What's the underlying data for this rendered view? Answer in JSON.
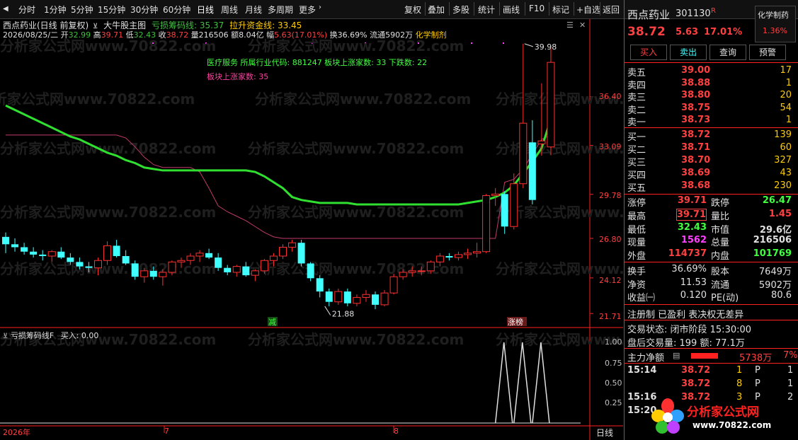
{
  "toolbar": {
    "periods": [
      "分时",
      "1分钟",
      "5分钟",
      "15分钟",
      "30分钟",
      "60分钟",
      "日线",
      "周线",
      "月线",
      "多周期",
      "更多"
    ],
    "right": [
      "复权",
      "叠加",
      "多股",
      "统计",
      "画线",
      "F10",
      "标记",
      "+自选",
      "返回"
    ]
  },
  "header": {
    "title": "西点药业(日线 前复权)",
    "template": "大牛股主图",
    "ind1_label": "亏损筹码线",
    "ind1_val": "35.37",
    "ind2_label": "拉升资金线",
    "ind2_val": "33.45",
    "date": "2026/08/25/二",
    "open_l": "开",
    "open": "32.99",
    "high_l": "高",
    "high": "39.71",
    "low_l": "低",
    "low": "32.43",
    "close_l": "收",
    "close": "38.72",
    "vol_l": "量",
    "vol": "216506",
    "amt_l": "额",
    "amt": "8.04亿",
    "chg_l": "幅",
    "chg": "5.63(17.01%)",
    "turn_l": "换",
    "turn": "36.69%",
    "float_l": "流通",
    "float": "5902万",
    "concept": "化学制剂"
  },
  "annotations": {
    "industry": "医疗服务  所属行业代码: 881247 板块上涨家数: 33 下跌数: 22",
    "up_count": "板块上涨家数: 35",
    "high_mark": "39.98",
    "low_mark": "21.88",
    "tag_reduce": "减",
    "tag_limit": "涨榜",
    "watermark": "分析家公式网www.70822.com"
  },
  "y_axis": [
    "36.40",
    "33.09",
    "29.78",
    "26.80",
    "24.12",
    "21.71"
  ],
  "indicator": {
    "title": "亏损筹码线F",
    "buy_label": "买入:",
    "buy_val": "0.00",
    "y_axis": [
      "1.00",
      "0.75",
      "0.50",
      "0.25"
    ]
  },
  "x_axis": [
    "2026年",
    "7",
    "8"
  ],
  "period_label": "日线",
  "stock": {
    "name": "西点药业",
    "code": "301130",
    "flag": "R",
    "price": "38.72",
    "change": "5.63",
    "pct": "17.01%",
    "concept": "化学制药",
    "concept_pct": "1.36%"
  },
  "buttons": [
    "买入",
    "卖出",
    "查询",
    "预警"
  ],
  "asks": [
    {
      "label": "卖五",
      "price": "39.00",
      "vol": "17"
    },
    {
      "label": "卖四",
      "price": "38.88",
      "vol": "1"
    },
    {
      "label": "卖三",
      "price": "38.80",
      "vol": "20"
    },
    {
      "label": "卖二",
      "price": "38.75",
      "vol": "54"
    },
    {
      "label": "卖一",
      "price": "38.73",
      "vol": "1"
    }
  ],
  "bids": [
    {
      "label": "买一",
      "price": "38.72",
      "vol": "139"
    },
    {
      "label": "买二",
      "price": "38.71",
      "vol": "60"
    },
    {
      "label": "买三",
      "price": "38.70",
      "vol": "327"
    },
    {
      "label": "买四",
      "price": "38.69",
      "vol": "43"
    },
    {
      "label": "买五",
      "price": "38.68",
      "vol": "230"
    }
  ],
  "stats": [
    {
      "l": "涨停",
      "v": "39.71",
      "l2": "跌停",
      "v2": "26.47"
    },
    {
      "l": "最高",
      "v": "39.71",
      "l2": "量比",
      "v2": "1.45"
    },
    {
      "l": "最低",
      "v": "32.43",
      "l2": "市值",
      "v2": "29.6亿"
    },
    {
      "l": "现量",
      "v": "1562",
      "l2": "总量",
      "v2": "216506"
    },
    {
      "l": "外盘",
      "v": "114737",
      "l2": "内盘",
      "v2": "101769"
    }
  ],
  "fin": [
    {
      "l": "换手",
      "v": "36.69%",
      "l2": "股本",
      "v2": "7649万"
    },
    {
      "l": "净资",
      "v": "11.53",
      "l2": "流通",
      "v2": "5902万"
    },
    {
      "l": "收益㈠",
      "v": "0.120",
      "l2": "PE(动)",
      "v2": "80.6"
    }
  ],
  "info": {
    "reg": "注册制 已盈利 表决权无差异",
    "status": "交易状态: 闭市阶段 15:30:00",
    "after": "盘后交易量: 199  额: 77.1万",
    "main_label": "主力净额",
    "main_val": "5738万",
    "main_pct": "7%"
  },
  "ticks": [
    {
      "t": "15:14",
      "p": "38.72",
      "v": "1",
      "s": "P",
      "n": "1"
    },
    {
      "t": "",
      "p": "38.72",
      "v": "8",
      "s": "P",
      "n": "1"
    },
    {
      "t": "15:16",
      "p": "38.72",
      "v": "3",
      "s": "P",
      "n": "2"
    },
    {
      "t": "15:20",
      "p": "",
      "v": "",
      "s": "",
      "n": ""
    }
  ],
  "logo": {
    "text": "分析家公式网",
    "url": "www.70822.com"
  },
  "chart_data": {
    "type": "candlestick",
    "ylim": [
      21.0,
      40.5
    ],
    "candles": [
      [
        26.9,
        27.2,
        25.8,
        26.4
      ],
      [
        26.4,
        26.8,
        25.9,
        26.2
      ],
      [
        26.2,
        26.5,
        25.7,
        25.9
      ],
      [
        25.9,
        26.2,
        25.5,
        25.7
      ],
      [
        25.7,
        26.0,
        25.3,
        25.6
      ],
      [
        25.6,
        26.0,
        25.2,
        25.9
      ],
      [
        25.9,
        26.2,
        25.4,
        25.5
      ],
      [
        25.5,
        25.8,
        25.0,
        25.2
      ],
      [
        25.2,
        25.5,
        24.7,
        24.9
      ],
      [
        24.9,
        25.2,
        24.5,
        24.8
      ],
      [
        24.8,
        25.5,
        24.3,
        25.3
      ],
      [
        25.3,
        26.6,
        25.0,
        26.3
      ],
      [
        26.3,
        26.7,
        25.5,
        25.6
      ],
      [
        25.6,
        26.0,
        25.0,
        25.1
      ],
      [
        25.1,
        25.3,
        24.0,
        24.2
      ],
      [
        24.2,
        24.8,
        23.8,
        24.6
      ],
      [
        24.6,
        24.9,
        24.0,
        24.2
      ],
      [
        24.2,
        24.7,
        23.6,
        24.5
      ],
      [
        24.5,
        25.3,
        24.3,
        25.2
      ],
      [
        25.2,
        25.5,
        24.8,
        25.3
      ],
      [
        25.3,
        25.8,
        25.0,
        25.6
      ],
      [
        25.6,
        26.0,
        25.2,
        25.8
      ],
      [
        25.8,
        26.1,
        25.4,
        25.5
      ],
      [
        25.5,
        25.8,
        24.6,
        24.8
      ],
      [
        24.8,
        25.0,
        24.3,
        24.5
      ],
      [
        24.5,
        25.0,
        24.2,
        24.9
      ],
      [
        24.9,
        25.2,
        24.2,
        24.3
      ],
      [
        24.3,
        24.7,
        23.9,
        24.6
      ],
      [
        24.6,
        25.4,
        24.4,
        25.3
      ],
      [
        25.3,
        25.8,
        24.9,
        25.6
      ],
      [
        25.6,
        26.4,
        25.4,
        26.2
      ],
      [
        26.2,
        26.7,
        25.9,
        26.5
      ],
      [
        26.5,
        26.7,
        24.9,
        25.1
      ],
      [
        25.1,
        25.2,
        23.9,
        24.1
      ],
      [
        24.1,
        24.3,
        22.8,
        23.2
      ],
      [
        23.2,
        23.4,
        22.2,
        22.5
      ],
      [
        22.5,
        23.4,
        22.3,
        23.2
      ],
      [
        23.2,
        23.4,
        22.2,
        22.4
      ],
      [
        22.4,
        23.0,
        22.2,
        22.8
      ],
      [
        22.8,
        23.3,
        22.5,
        23.0
      ],
      [
        23.0,
        23.2,
        22.0,
        22.3
      ],
      [
        22.3,
        23.3,
        22.2,
        23.1
      ],
      [
        23.1,
        24.4,
        23.0,
        24.2
      ],
      [
        24.2,
        24.7,
        24.0,
        24.5
      ],
      [
        24.5,
        24.9,
        24.2,
        24.6
      ],
      [
        24.6,
        24.9,
        24.3,
        24.6
      ],
      [
        24.6,
        25.3,
        24.4,
        25.2
      ],
      [
        25.2,
        25.8,
        24.9,
        25.6
      ],
      [
        25.6,
        25.8,
        25.3,
        25.5
      ],
      [
        25.5,
        25.9,
        25.3,
        25.7
      ],
      [
        25.7,
        26.1,
        25.4,
        25.8
      ],
      [
        25.8,
        26.5,
        25.5,
        25.9
      ],
      [
        25.9,
        29.8,
        25.8,
        29.7
      ],
      [
        29.7,
        30.2,
        29.0,
        29.8
      ],
      [
        29.8,
        30.0,
        27.1,
        27.6
      ],
      [
        27.6,
        31.2,
        27.4,
        30.5
      ],
      [
        30.5,
        39.98,
        30.2,
        34.6
      ],
      [
        33.3,
        34.8,
        29.1,
        29.4
      ],
      [
        33.2,
        37.3,
        32.4,
        33.4
      ],
      [
        32.99,
        39.71,
        32.43,
        38.72
      ]
    ],
    "line_green": [
      35.8,
      35.5,
      35.2,
      34.9,
      34.6,
      34.3,
      34.0,
      33.7,
      33.5,
      33.2,
      32.9,
      32.6,
      32.4,
      32.1,
      31.9,
      31.6,
      31.5,
      31.4,
      31.4,
      31.4,
      31.4,
      31.4,
      31.4,
      31.4,
      31.4,
      31.4,
      31.4,
      31.3,
      31.0,
      30.6,
      30.2,
      29.6,
      29.4,
      29.3,
      29.2,
      29.2,
      29.2,
      29.2,
      29.1,
      29.1,
      29.1,
      29.1,
      29.1,
      29.1,
      29.1,
      29.1,
      29.1,
      29.1,
      29.1,
      29.1,
      29.2,
      29.3,
      29.4,
      29.6,
      29.9,
      30.4,
      31.2,
      32.0,
      32.9,
      34.9
    ],
    "line_pink": [
      33.8,
      33.8,
      33.8,
      33.8,
      33.8,
      33.8,
      33.8,
      33.8,
      33.8,
      33.8,
      33.8,
      33.8,
      33.8,
      33.6,
      33.0,
      32.3,
      31.8,
      31.6,
      31.6,
      31.6,
      31.6,
      31.3,
      30.2,
      29.0,
      28.6,
      28.3,
      28.0,
      27.6,
      27.2,
      26.9,
      26.8,
      26.8,
      26.8,
      26.8,
      26.8,
      26.8,
      26.8,
      26.8,
      26.8,
      26.8,
      26.8,
      26.8,
      26.8,
      26.8,
      26.8,
      26.8,
      26.8,
      26.8,
      26.8,
      26.8,
      26.8,
      26.8,
      26.8,
      26.8,
      30.6,
      30.8,
      31.5,
      32.5,
      33.5,
      33.8
    ],
    "indicator_values": [
      0,
      0,
      0,
      0,
      0,
      0,
      0,
      0,
      0,
      0,
      0,
      0,
      0,
      0,
      0,
      0,
      0,
      0,
      0,
      0,
      0,
      0,
      0,
      0,
      0,
      0,
      0,
      0,
      0,
      0,
      0,
      0,
      0,
      0,
      0,
      0,
      0,
      0,
      0,
      0,
      0,
      0,
      0,
      0,
      0,
      0,
      0,
      0,
      0,
      0,
      0,
      0,
      0,
      0,
      1,
      0,
      1,
      0,
      1,
      0
    ]
  }
}
